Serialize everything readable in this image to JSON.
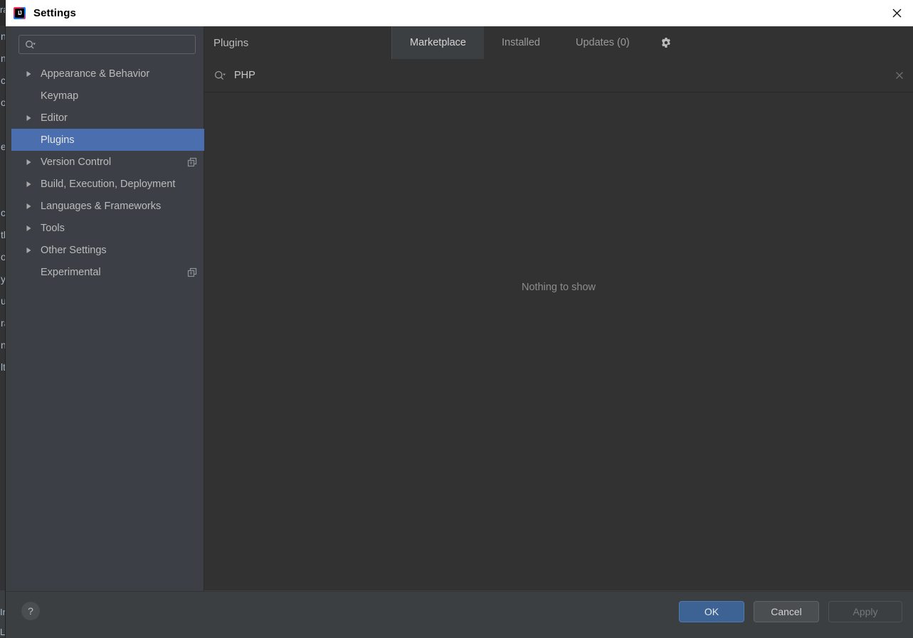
{
  "background": {
    "left_text_fragments": [
      "n",
      "n",
      "c",
      "o",
      "",
      "e",
      "",
      "",
      "ch",
      "th",
      "o",
      "yl",
      "u",
      "ra",
      "ni",
      "lt"
    ],
    "bottom_left_fragment": "In",
    "bottom_status_fragment": "Login",
    "top_left_fragment": "ra"
  },
  "dialog": {
    "title": "Settings",
    "logo_text": "IJ",
    "close_icon": "close-icon"
  },
  "sidebar": {
    "search": {
      "value": "",
      "placeholder": "",
      "icon": "search-icon"
    },
    "items": [
      {
        "label": "Appearance & Behavior",
        "expandable": true,
        "selected": false,
        "badge": false
      },
      {
        "label": "Keymap",
        "expandable": false,
        "selected": false,
        "badge": false
      },
      {
        "label": "Editor",
        "expandable": true,
        "selected": false,
        "badge": false
      },
      {
        "label": "Plugins",
        "expandable": false,
        "selected": true,
        "badge": false
      },
      {
        "label": "Version Control",
        "expandable": true,
        "selected": false,
        "badge": true
      },
      {
        "label": "Build, Execution, Deployment",
        "expandable": true,
        "selected": false,
        "badge": false
      },
      {
        "label": "Languages & Frameworks",
        "expandable": true,
        "selected": false,
        "badge": false
      },
      {
        "label": "Tools",
        "expandable": true,
        "selected": false,
        "badge": false
      },
      {
        "label": "Other Settings",
        "expandable": true,
        "selected": false,
        "badge": false
      },
      {
        "label": "Experimental",
        "expandable": false,
        "selected": false,
        "badge": true
      }
    ]
  },
  "plugins": {
    "title": "Plugins",
    "tabs": [
      {
        "label": "Marketplace",
        "active": true
      },
      {
        "label": "Installed",
        "active": false
      },
      {
        "label": "Updates (0)",
        "active": false
      }
    ],
    "settings_icon": "gear-icon",
    "search": {
      "value": "PHP",
      "placeholder": "",
      "icon": "search-icon",
      "clear_icon": "close-icon"
    },
    "empty_state": "Nothing to show"
  },
  "footer": {
    "help_label": "?",
    "ok_label": "OK",
    "cancel_label": "Cancel",
    "apply_label": "Apply"
  },
  "colors": {
    "accent_selection": "#4b6eaf",
    "ok_button": "#3c6394",
    "sidebar_bg": "#3c4046",
    "content_bg": "#323232",
    "dialog_bg": "#3c3f41",
    "text_primary": "#bbbbbb",
    "text_muted": "#8d8d8d"
  }
}
